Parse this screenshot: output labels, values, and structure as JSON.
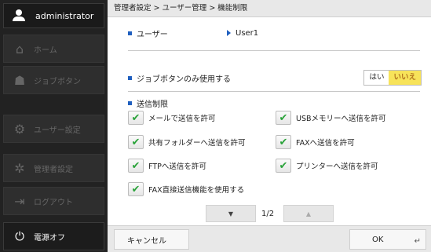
{
  "sidebar": {
    "user": "administrator",
    "items": [
      {
        "label": "ホーム",
        "icon": "home-icon"
      },
      {
        "label": "ジョブボタン",
        "icon": "job-button-icon"
      },
      {
        "label": "ユーザー設定",
        "icon": "user-settings-icon"
      },
      {
        "label": "管理者設定",
        "icon": "admin-settings-icon"
      },
      {
        "label": "ログアウト",
        "icon": "logout-icon"
      }
    ],
    "power": {
      "label": "電源オフ",
      "icon": "power-icon"
    }
  },
  "breadcrumb": "管理者設定 > ユーザー管理 > 機能制限",
  "user_row": {
    "label": "ユーザー",
    "value": "User1"
  },
  "job_row": {
    "label": "ジョブボタンのみ使用する",
    "yes": "はい",
    "no": "いいえ",
    "selected": "no"
  },
  "send_section": {
    "title": "送信制限",
    "options": [
      {
        "label": "メールで送信を許可",
        "checked": true
      },
      {
        "label": "USBメモリーへ送信を許可",
        "checked": true
      },
      {
        "label": "共有フォルダーへ送信を許可",
        "checked": true
      },
      {
        "label": "FAXへ送信を許可",
        "checked": true
      },
      {
        "label": "FTPへ送信を許可",
        "checked": true
      },
      {
        "label": "プリンターへ送信を許可",
        "checked": true
      },
      {
        "label": "FAX直接送信機能を使用する",
        "checked": true
      }
    ]
  },
  "pager": {
    "text": "1/2",
    "down": "▼",
    "up": "▲"
  },
  "buttons": {
    "cancel": "キャンセル",
    "ok": "OK"
  },
  "colors": {
    "accent": "#1f5fbf",
    "check": "#2aa33a",
    "selected_bg": "#f7e35a",
    "sidebar_bg": "#222222"
  }
}
